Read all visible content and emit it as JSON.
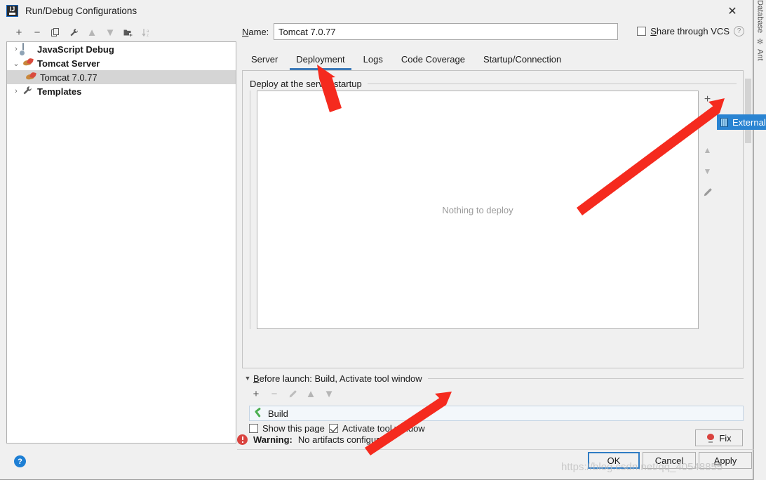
{
  "window": {
    "title": "Run/Debug Configurations",
    "app_icon": "intellij-idea-icon",
    "close_icon": "✕"
  },
  "ide_strip": {
    "items": [
      {
        "label": "Database",
        "icon": "database-icon"
      },
      {
        "label": "Ant",
        "icon": "ant-icon"
      }
    ]
  },
  "left_panel": {
    "toolbar": [
      {
        "name": "add",
        "glyph": "+",
        "enabled": true
      },
      {
        "name": "remove",
        "glyph": "−",
        "enabled": true
      },
      {
        "name": "copy",
        "glyph": "⎘",
        "enabled": true
      },
      {
        "name": "edit-templates",
        "glyph": "🔧",
        "enabled": true
      },
      {
        "name": "move-up",
        "glyph": "▲",
        "enabled": false
      },
      {
        "name": "move-down",
        "glyph": "▼",
        "enabled": false
      },
      {
        "name": "move-into-folder",
        "glyph": "🗀",
        "enabled": true
      },
      {
        "name": "sort-alphabetically",
        "glyph": "↓az",
        "enabled": false
      }
    ],
    "tree": [
      {
        "label": "JavaScript Debug",
        "icon": "javascript-debug-icon",
        "twisty": "›",
        "bold": true,
        "selected": false,
        "indent": 0
      },
      {
        "label": "Tomcat Server",
        "icon": "tomcat-icon",
        "twisty": "⌄",
        "bold": true,
        "selected": false,
        "indent": 0
      },
      {
        "label": "Tomcat 7.0.77",
        "icon": "tomcat-icon",
        "twisty": "",
        "bold": false,
        "selected": true,
        "indent": 1
      },
      {
        "label": "Templates",
        "icon": "wrench-icon",
        "twisty": "›",
        "bold": true,
        "selected": false,
        "indent": 0
      }
    ]
  },
  "form": {
    "name_label": "Name:",
    "name_label_mnemonic": "N",
    "name_label_rest": "ame:",
    "name_value": "Tomcat 7.0.77",
    "name_placeholder": "",
    "share_vcs_label": "Share through VCS",
    "share_vcs_mnemonic": "S",
    "share_vcs_rest": "hare through VCS",
    "share_vcs_checked": false,
    "help_icon": "?"
  },
  "tabs": [
    {
      "label": "Server",
      "active": false
    },
    {
      "label": "Deployment",
      "active": true
    },
    {
      "label": "Logs",
      "active": false
    },
    {
      "label": "Code Coverage",
      "active": false
    },
    {
      "label": "Startup/Connection",
      "active": false
    }
  ],
  "deployment": {
    "group_title": "Deploy at the server startup",
    "empty_text": "Nothing to deploy",
    "tools": [
      {
        "name": "add-artifact",
        "glyph": "+",
        "enabled": true
      },
      {
        "name": "move-up",
        "glyph": "▲",
        "enabled": false
      },
      {
        "name": "move-down",
        "glyph": "▼",
        "enabled": false
      },
      {
        "name": "edit-artifact",
        "glyph": "✎",
        "enabled": false
      }
    ],
    "popup": {
      "item_label": "External",
      "item_icon": "external-source-icon",
      "highlight_color": "#2a84d2"
    }
  },
  "before_launch": {
    "title_mnemonic": "B",
    "title_rest": "efore launch: Build, Activate tool window",
    "twisty": "▼",
    "toolbar": [
      {
        "name": "add-task",
        "glyph": "+",
        "enabled": true
      },
      {
        "name": "remove-task",
        "glyph": "−",
        "enabled": false
      },
      {
        "name": "edit-task",
        "glyph": "✎",
        "enabled": false
      },
      {
        "name": "move-task-up",
        "glyph": "▲",
        "enabled": false
      },
      {
        "name": "move-task-down",
        "glyph": "▼",
        "enabled": false
      }
    ],
    "tasks": [
      {
        "label": "Build",
        "icon": "build-hammer-icon"
      }
    ],
    "show_page_label": "Show this page",
    "show_page_checked": false,
    "activate_window_label": "Activate tool window",
    "activate_window_checked": true
  },
  "status": {
    "warning_prefix": "Warning:",
    "warning_text": "No artifacts configured",
    "warning_icon": "error-circle-icon",
    "warning_color": "#d9433f"
  },
  "buttons": {
    "fix": "Fix",
    "ok": "OK",
    "cancel": "Cancel",
    "apply_mnemonic": "A",
    "apply_rest": "pply",
    "help": "?"
  },
  "watermark": "https://blog.csdn.net/qq_40548855",
  "annotations": {
    "arrow_color": "#f52a1e",
    "arrows": [
      {
        "name": "arrow-to-deployment-tab"
      },
      {
        "name": "arrow-to-add-artifact-button"
      },
      {
        "name": "arrow-to-warning"
      }
    ]
  },
  "colors": {
    "accent": "#3d7ab8",
    "selection": "#2a84d2",
    "window_bg": "#f0f0f0",
    "field_bg": "#ffffff"
  }
}
